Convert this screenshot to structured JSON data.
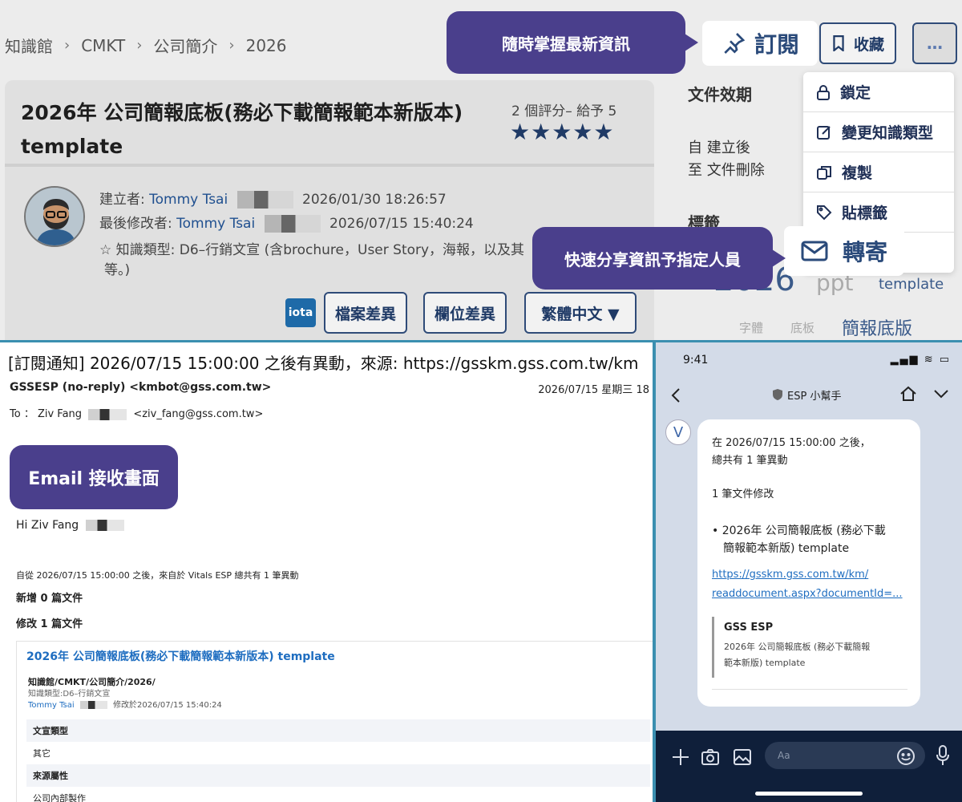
{
  "breadcrumb": {
    "items": [
      "知識館",
      "CMKT",
      "公司簡介",
      "2026"
    ],
    "sep": "›"
  },
  "top_actions": {
    "subscribe": "訂閱",
    "favorite": "收藏",
    "more": "…"
  },
  "callouts": {
    "subscribe": "隨時掌握最新資訊",
    "forward": "快速分享資訊予指定人員",
    "email": "Email 接收畫面"
  },
  "doc": {
    "title": "2026年 公司簡報底板(務必下載簡報範本新版本) template",
    "rating_text": "2 個評分– 給予 5",
    "stars": "★★★★★",
    "rating": 5,
    "creator_label": "建立者:",
    "creator": "Tommy Tsai",
    "created_at": "2026/01/30 18:26:57",
    "modifier_label": "最後修改者:",
    "modifier": "Tommy Tsai",
    "modified_at": "2026/07/15 15:40:24",
    "type_label": "☆ 知識類型: D6–行銷文宣 (含brochure，User Story，海報，以及其",
    "type_cont": "等。)"
  },
  "actions": {
    "iota": "iota",
    "file_diff": "檔案差異",
    "field_diff": "欄位差異",
    "language": "繁體中文 ▼"
  },
  "right_panel": {
    "validity": "文件效期",
    "from_label": "自 建立後",
    "to_label": "至 文件刪除",
    "tags": "標籤"
  },
  "dropdown": {
    "lock": "鎖定",
    "change_type": "變更知識類型",
    "copy": "複製",
    "tag": "貼標籤"
  },
  "forward": "轉寄",
  "tags": {
    "year": "2026",
    "ppt": "ppt",
    "template": "template",
    "font": "字體",
    "base": "底板",
    "deck": "簡報底版"
  },
  "email": {
    "subject": "[訂閱通知] 2026/07/15 15:00:00 之後有異動，來源: https://gsskm.gss.com.tw/km",
    "from": "GSSESP (no-reply) <kmbot@gss.com.tw>",
    "date": "2026/07/15 星期三 18",
    "to_label": "To ： Ziv Fang",
    "to_addr": "<ziv_fang@gss.com.tw>",
    "greeting": "Hi Ziv Fang",
    "summary": "自從 2026/07/15 15:00:00 之後，來自於 Vitals ESP 總共有 1 筆異動",
    "added": "新增 0 篇文件",
    "modified": "修改 1 篇文件",
    "doc_link": "2026年 公司簡報底板(務必下載簡報範本新版本) template",
    "path": "知識館/CMKT/公司簡介/2026/",
    "doc_type": "知識類型:D6–行銷文宣",
    "mod_user": "Tommy Tsai",
    "mod_text": "修改於2026/07/15 15:40:24",
    "row1_head": "文宣類型",
    "row1_val": "其它",
    "row2_head": "來源屬性",
    "row2_val": "公司內部製作"
  },
  "chat": {
    "time": "9:41",
    "status": "▂▄▆ ≋ ▭",
    "title": "ESP 小幫手",
    "avatar": "V",
    "line1": "在 2026/07/15 15:00:00 之後，",
    "line2": "總共有 1 筆異動",
    "line3": "1 筆文件修改",
    "bullet1": "• 2026年 公司簡報底板 (務必下載",
    "bullet2": "簡報範本新版) template",
    "link1": "https://gsskm.gss.com.tw/km/",
    "link2": "readdocument.aspx?documentId=...",
    "quote_title": "GSS ESP",
    "quote1": "2026年 公司簡報底板 (務必下載簡報",
    "quote2": "範本新版) template",
    "input_placeholder": "Aa"
  }
}
